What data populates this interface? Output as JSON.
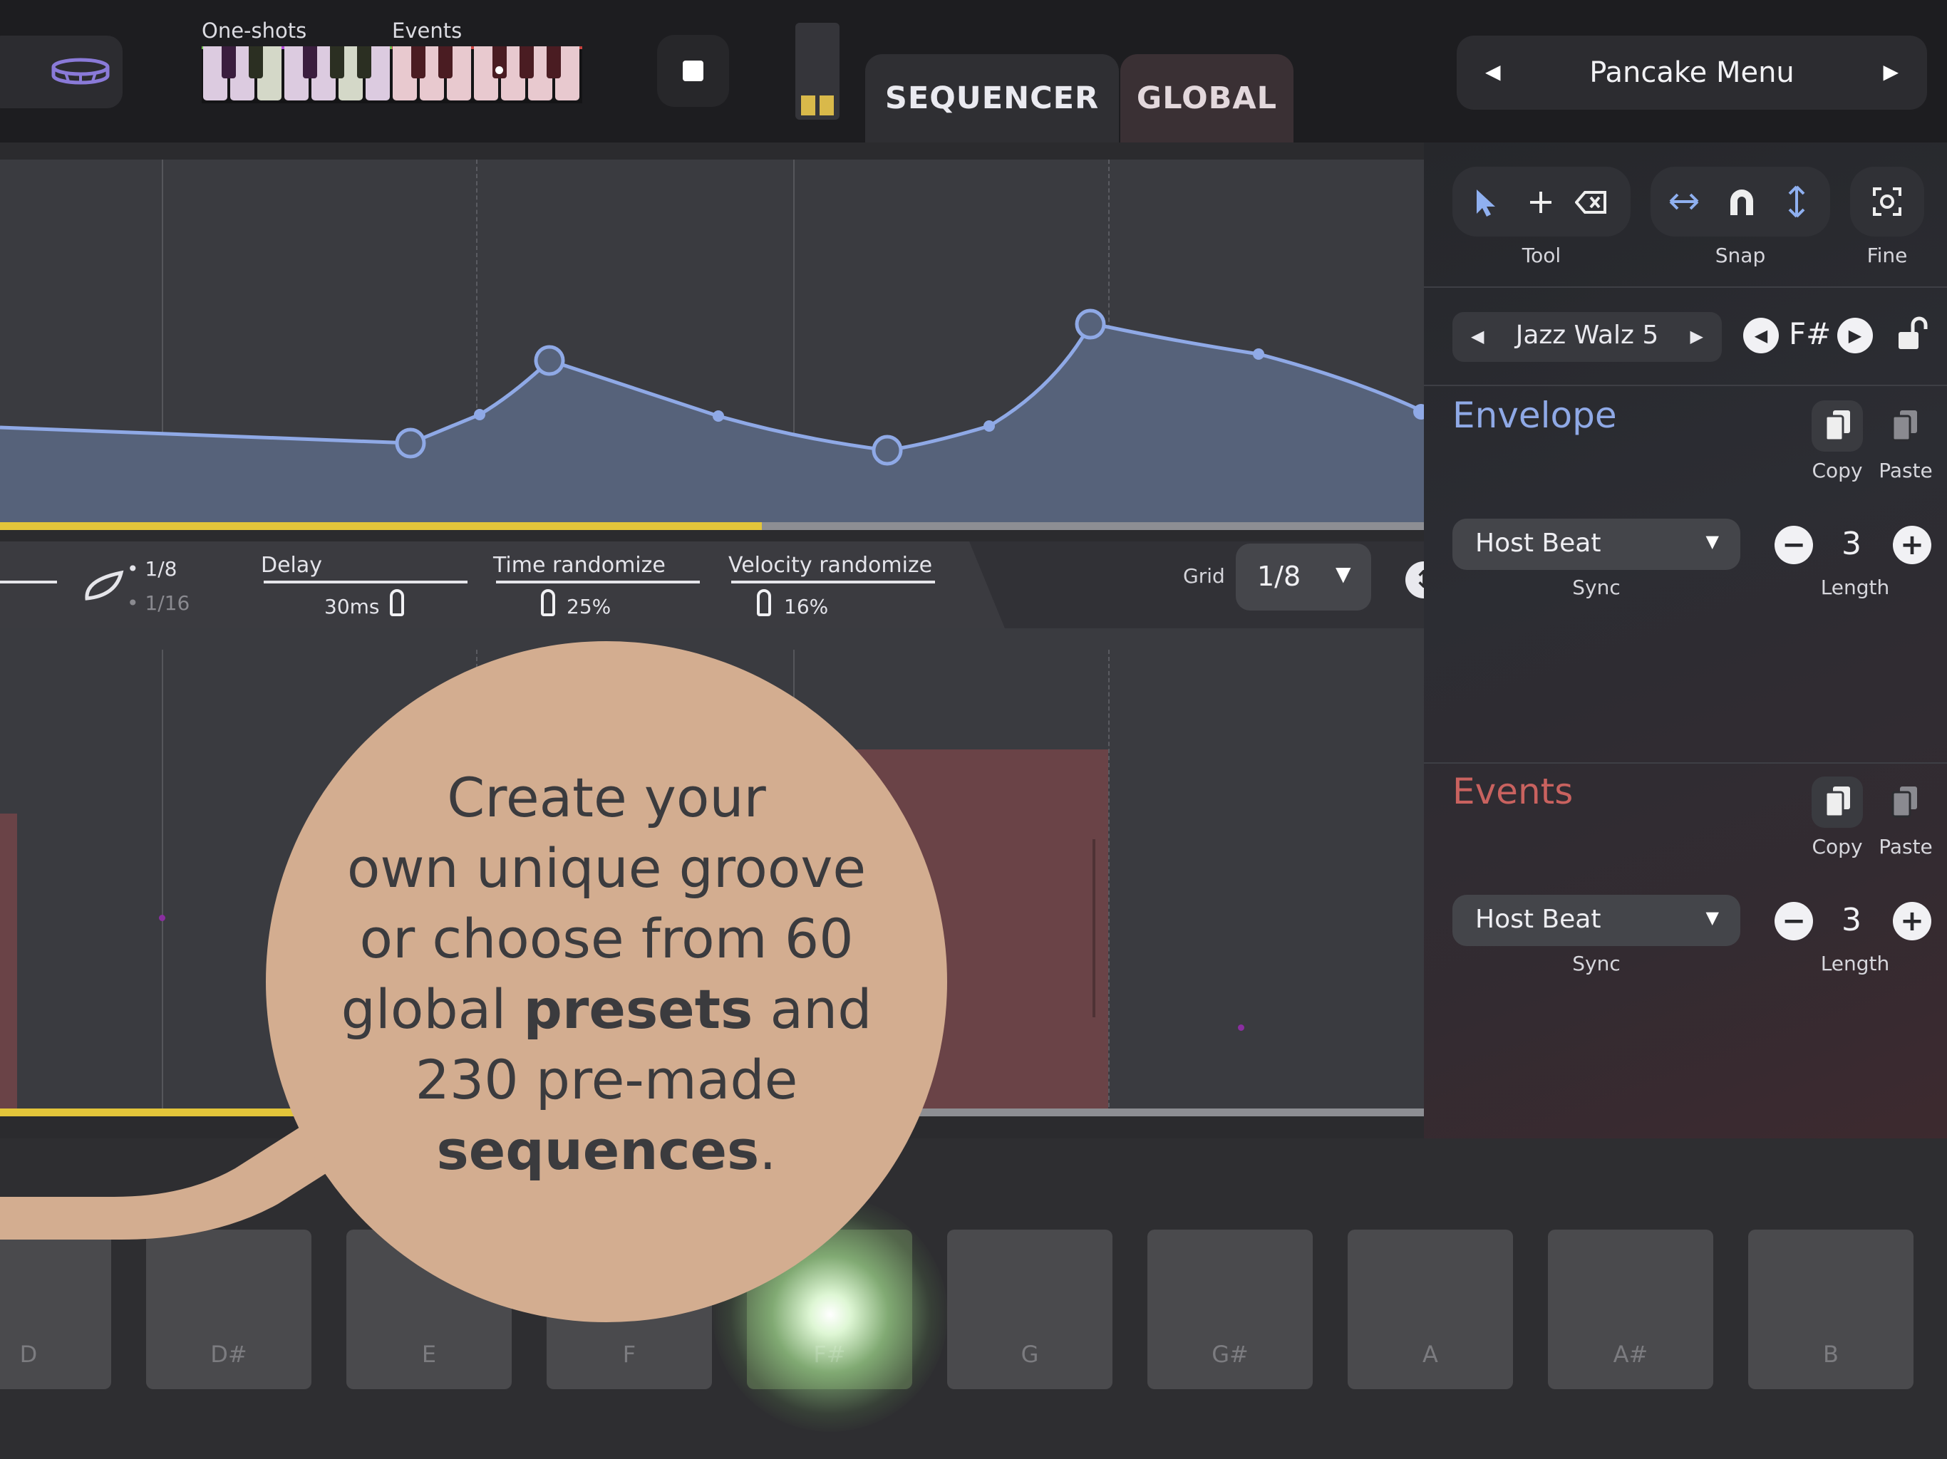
{
  "topbar": {
    "oneshots_label": "One-shots",
    "events_label": "Events",
    "tabs": [
      {
        "label": "SEQUENCER",
        "active": true
      },
      {
        "label": "GLOBAL",
        "active": false
      }
    ],
    "preset": {
      "name": "Pancake Menu",
      "prev_icon": "triangle-left-icon",
      "next_icon": "triangle-right-icon"
    }
  },
  "params": {
    "swing_top": "1/8",
    "swing_bottom": "1/16",
    "delay": {
      "label": "Delay",
      "value": "30ms"
    },
    "time_randomize": {
      "label": "Time randomize",
      "value": "25%"
    },
    "velocity_randomize": {
      "label": "Velocity randomize",
      "value": "16%"
    },
    "grid": {
      "label": "Grid",
      "value": "1/8"
    }
  },
  "sidebar": {
    "tool_label": "Tool",
    "snap_label": "Snap",
    "fine_label": "Fine",
    "pattern": {
      "name": "Jazz Walz 5",
      "key": "F#"
    },
    "envelope": {
      "title": "Envelope",
      "title_color": "#8fa9e6",
      "copy_label": "Copy",
      "paste_label": "Paste",
      "sync_value": "Host Beat",
      "sync_label": "Sync",
      "length_value": "3",
      "length_label": "Length"
    },
    "events": {
      "title": "Events",
      "title_color": "#c9625f",
      "copy_label": "Copy",
      "paste_label": "Paste",
      "sync_value": "Host Beat",
      "sync_label": "Sync",
      "length_value": "3",
      "length_label": "Length"
    }
  },
  "keys": [
    "D",
    "D#",
    "E",
    "F",
    "F#",
    "G",
    "G#",
    "A",
    "A#",
    "B"
  ],
  "active_key": "F#",
  "playhead_progress": 0.535,
  "callout": {
    "line1": "Create your",
    "line2": "own unique groove",
    "line3": "or choose from 60",
    "line4_pre": "global ",
    "line4_bold": "presets",
    "line4_post": " and",
    "line5": "230 pre-made",
    "line6_bold": "sequences",
    "line6_post": "."
  },
  "colors": {
    "accent_yellow": "#e3c53a",
    "envelope_fill": "#56627a",
    "envelope_line": "#8fa9e6",
    "event_block": "#6a4347",
    "callout_bg": "#d3ad90"
  }
}
